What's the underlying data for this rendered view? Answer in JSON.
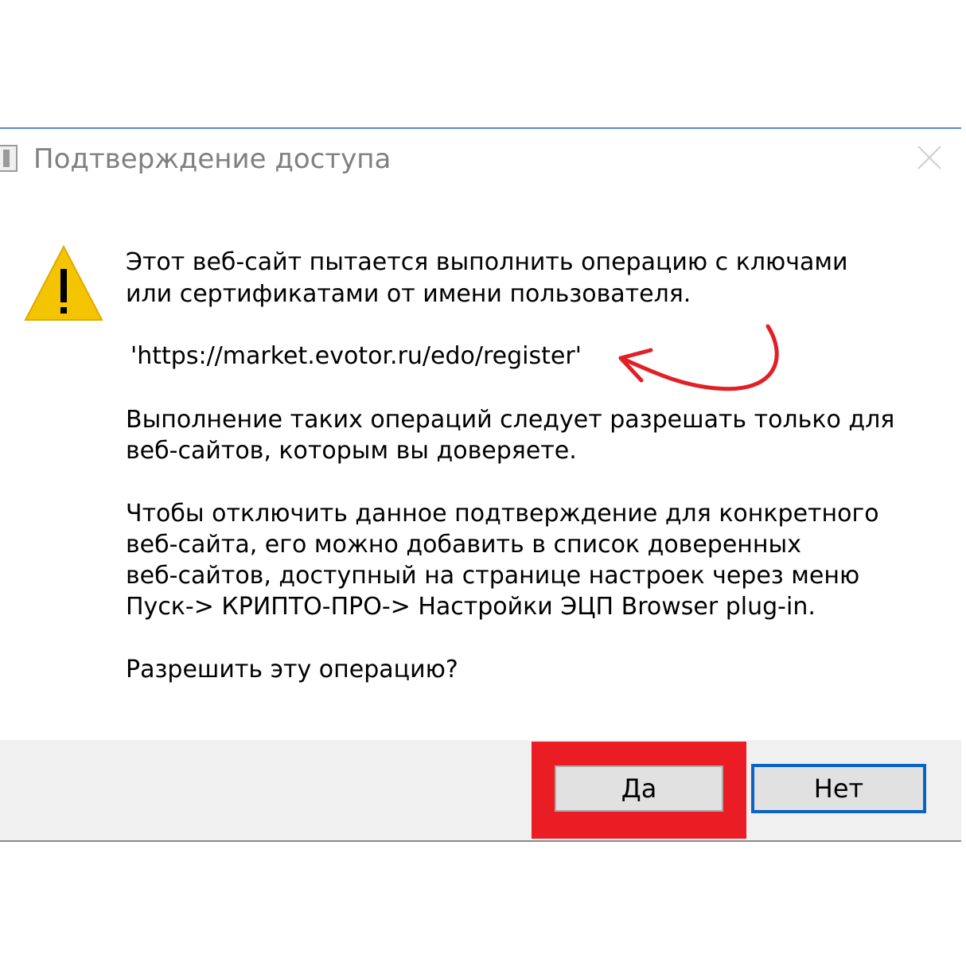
{
  "window": {
    "title": "Подтверждение доступа",
    "icons": {
      "app": "app-window-icon",
      "close": "close-icon",
      "warning": "warning-triangle-icon"
    }
  },
  "message": {
    "line1": "Этот веб-сайт пытается выполнить операцию с ключами",
    "line2": "или сертификатами от имени пользователя.",
    "url": "'https://market.evotor.ru/edo/register'",
    "line3": "Выполнение таких операций следует разрешать только для",
    "line4": "веб-сайтов, которым вы доверяете.",
    "line5": "Чтобы отключить данное подтверждение для конкретного",
    "line6": "веб-сайта, его можно добавить в список доверенных",
    "line7": "веб-сайтов, доступный на странице настроек через меню",
    "line8": "Пуск-> КРИПТО-ПРО-> Настройки ЭЦП Browser plug-in.",
    "question": "Разрешить эту операцию?"
  },
  "buttons": {
    "yes": "Да",
    "no": "Нет"
  },
  "colors": {
    "annotation": "#ea1c24",
    "focus_border": "#0a63c8",
    "warning": "#f5c400",
    "footer": "#f0f0f0"
  }
}
